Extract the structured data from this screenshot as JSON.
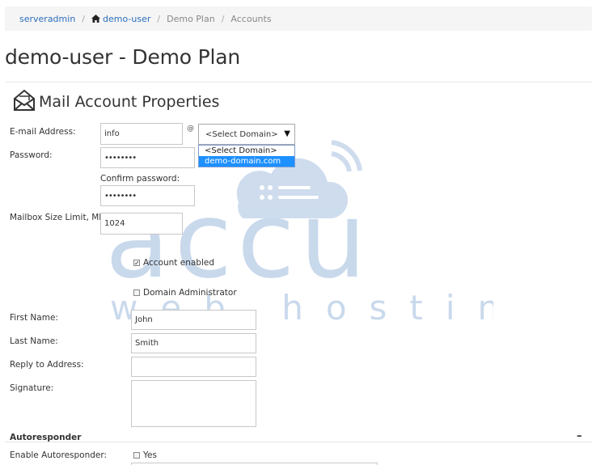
{
  "breadcrumb": {
    "items": [
      "serveradmin",
      "demo-user",
      "Demo Plan",
      "Accounts"
    ],
    "separator": "/"
  },
  "page": {
    "title": "demo-user - Demo Plan"
  },
  "section": {
    "title": "Mail Account Properties"
  },
  "form": {
    "email_label": "E-mail Address:",
    "email_value": "info",
    "at_sign": "@",
    "domain_select_value": "<Select Domain>",
    "domain_options": [
      "<Select Domain>",
      "demo-domain.com"
    ],
    "password_label": "Password:",
    "password_value": "••••••••",
    "confirm_label": "Confirm password:",
    "confirm_value": "••••••••",
    "mailbox_label": "Mailbox Size Limit, MB:",
    "mailbox_value": "1024",
    "account_enabled_label": "Account enabled",
    "domain_admin_label": "Domain Administrator",
    "first_name_label": "First Name:",
    "first_name_value": "John",
    "last_name_label": "Last Name:",
    "last_name_value": "Smith",
    "reply_label": "Reply to Address:",
    "reply_value": "",
    "signature_label": "Signature:",
    "signature_value": ""
  },
  "autoresponder": {
    "title": "Autoresponder",
    "collapse_symbol": "–",
    "enable_label": "Enable Autoresponder:",
    "yes_label": "Yes"
  },
  "watermark": {
    "line1": "accu",
    "line2": "web hosting"
  },
  "colors": {
    "link": "#2a6ebb",
    "option_highlight": "#1e90ff",
    "watermark": "#c9d9ec"
  }
}
